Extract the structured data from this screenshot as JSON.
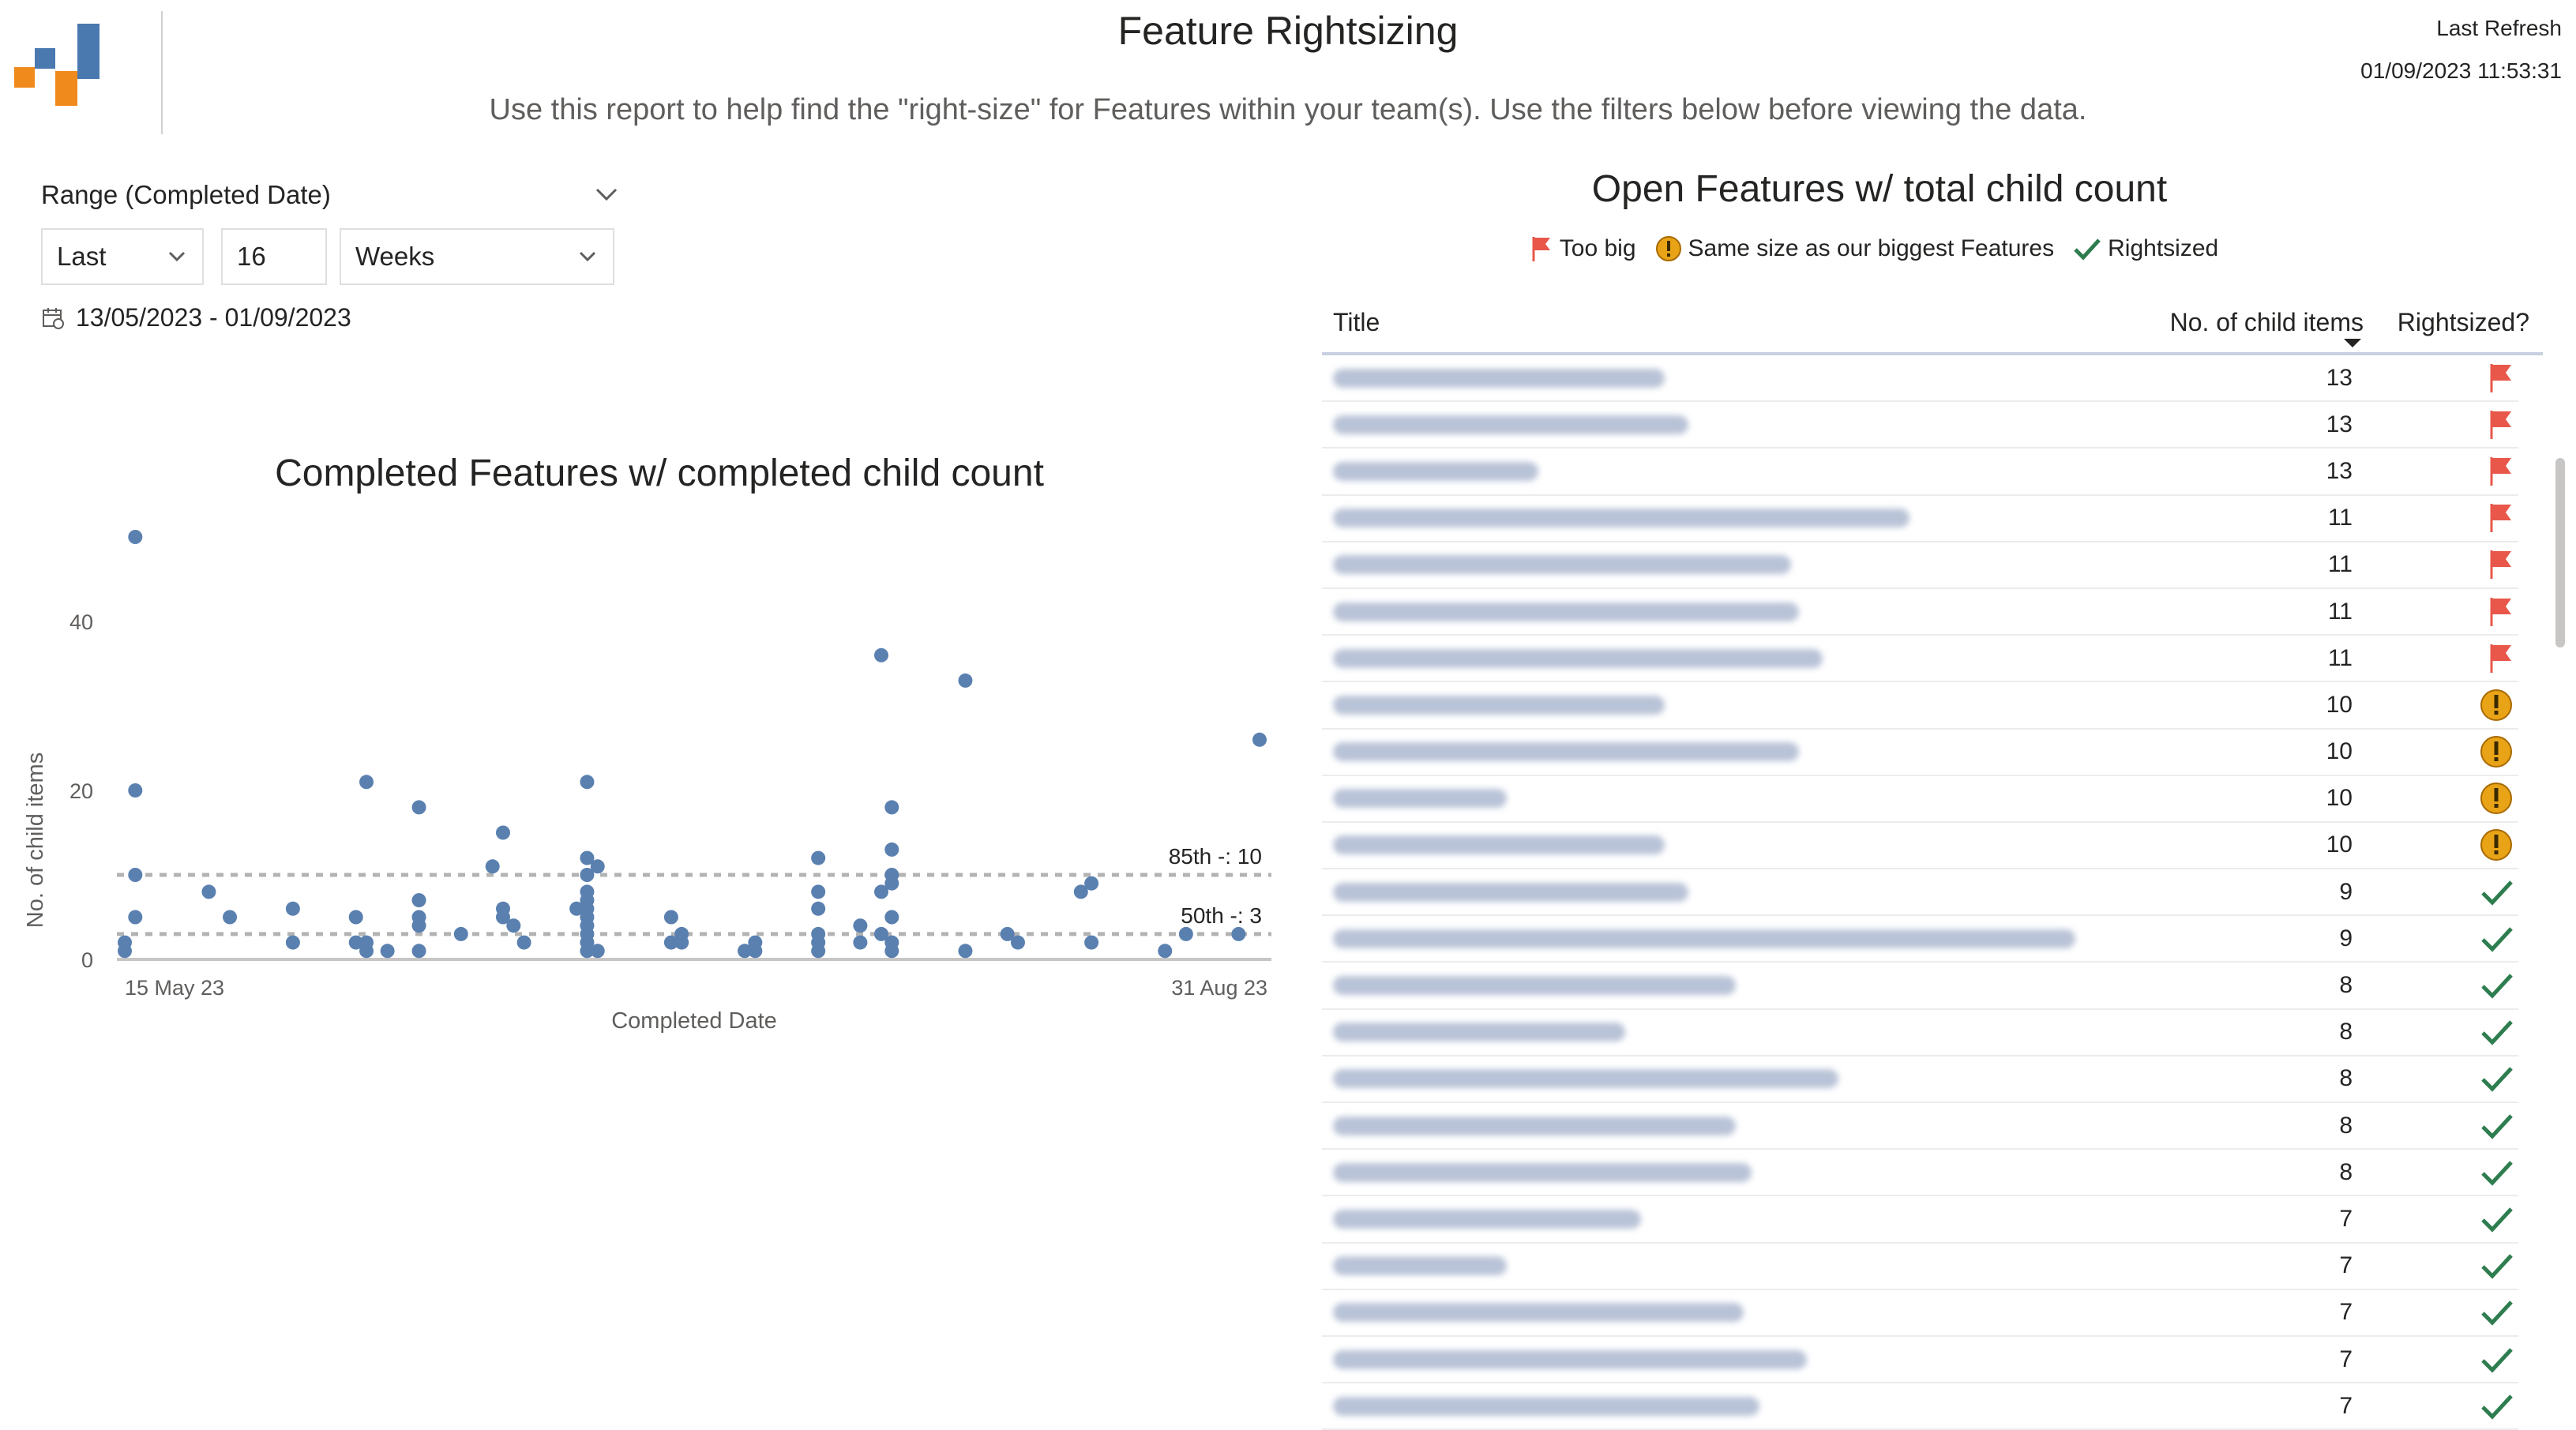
{
  "header": {
    "title": "Feature Rightsizing",
    "subtitle": "Use this report to help find the \"right-size\" for Features within your team(s). Use the filters below before viewing the data.",
    "last_refresh_label": "Last Refresh",
    "last_refresh_value": "01/09/2023 11:53:31"
  },
  "colors": {
    "logo_blue": "#4a79b0",
    "logo_orange": "#f08a1c",
    "dot": "#5a80b0",
    "flag": "#e8574a",
    "warning": "#e8a317",
    "check": "#2e7d4f"
  },
  "slicer": {
    "label": "Range (Completed Date)",
    "mode": "Last",
    "number": "16",
    "unit": "Weeks",
    "date_range": "13/05/2023 - 01/09/2023"
  },
  "scatter": {
    "title": "Completed Features w/ completed child count",
    "ylabel": "No. of child items",
    "xlabel": "Completed Date",
    "x_start_label": "15 May 23",
    "x_end_label": "31 Aug 23",
    "p85_label": "85th -: 10",
    "p50_label": "50th -: 3"
  },
  "chart_data": {
    "type": "scatter",
    "title": "Completed Features w/ completed child count",
    "xlabel": "Completed Date",
    "ylabel": "No. of child items",
    "yticks": [
      0,
      20,
      40
    ],
    "ylim": [
      0,
      50
    ],
    "xlim": [
      "2023-05-15",
      "2023-08-31"
    ],
    "x_tick_labels": [
      "15 May 23",
      "31 Aug 23"
    ],
    "reference_lines": [
      {
        "label": "85th -: 10",
        "value": 10,
        "style": "dotted"
      },
      {
        "label": "50th -: 3",
        "value": 3,
        "style": "dotted"
      }
    ],
    "series": [
      {
        "points": [
          {
            "x": "2023-05-15",
            "y": 2
          },
          {
            "x": "2023-05-15",
            "y": 1
          },
          {
            "x": "2023-05-16",
            "y": 50
          },
          {
            "x": "2023-05-16",
            "y": 20
          },
          {
            "x": "2023-05-16",
            "y": 10
          },
          {
            "x": "2023-05-16",
            "y": 5
          },
          {
            "x": "2023-05-23",
            "y": 8
          },
          {
            "x": "2023-05-25",
            "y": 5
          },
          {
            "x": "2023-05-31",
            "y": 6
          },
          {
            "x": "2023-05-31",
            "y": 2
          },
          {
            "x": "2023-06-06",
            "y": 5
          },
          {
            "x": "2023-06-06",
            "y": 2
          },
          {
            "x": "2023-06-07",
            "y": 21
          },
          {
            "x": "2023-06-07",
            "y": 2
          },
          {
            "x": "2023-06-07",
            "y": 1
          },
          {
            "x": "2023-06-09",
            "y": 1
          },
          {
            "x": "2023-06-12",
            "y": 18
          },
          {
            "x": "2023-06-12",
            "y": 7
          },
          {
            "x": "2023-06-12",
            "y": 5
          },
          {
            "x": "2023-06-12",
            "y": 4
          },
          {
            "x": "2023-06-12",
            "y": 1
          },
          {
            "x": "2023-06-16",
            "y": 3
          },
          {
            "x": "2023-06-19",
            "y": 11
          },
          {
            "x": "2023-06-20",
            "y": 15
          },
          {
            "x": "2023-06-20",
            "y": 6
          },
          {
            "x": "2023-06-20",
            "y": 5
          },
          {
            "x": "2023-06-21",
            "y": 4
          },
          {
            "x": "2023-06-22",
            "y": 2
          },
          {
            "x": "2023-06-27",
            "y": 6
          },
          {
            "x": "2023-06-28",
            "y": 21
          },
          {
            "x": "2023-06-28",
            "y": 12
          },
          {
            "x": "2023-06-28",
            "y": 10
          },
          {
            "x": "2023-06-28",
            "y": 8
          },
          {
            "x": "2023-06-28",
            "y": 7
          },
          {
            "x": "2023-06-28",
            "y": 6
          },
          {
            "x": "2023-06-28",
            "y": 5
          },
          {
            "x": "2023-06-28",
            "y": 4
          },
          {
            "x": "2023-06-28",
            "y": 3
          },
          {
            "x": "2023-06-28",
            "y": 2
          },
          {
            "x": "2023-06-28",
            "y": 1
          },
          {
            "x": "2023-06-29",
            "y": 11
          },
          {
            "x": "2023-06-29",
            "y": 1
          },
          {
            "x": "2023-07-06",
            "y": 5
          },
          {
            "x": "2023-07-06",
            "y": 2
          },
          {
            "x": "2023-07-07",
            "y": 3
          },
          {
            "x": "2023-07-07",
            "y": 2
          },
          {
            "x": "2023-07-13",
            "y": 1
          },
          {
            "x": "2023-07-14",
            "y": 2
          },
          {
            "x": "2023-07-14",
            "y": 1
          },
          {
            "x": "2023-07-20",
            "y": 12
          },
          {
            "x": "2023-07-20",
            "y": 8
          },
          {
            "x": "2023-07-20",
            "y": 6
          },
          {
            "x": "2023-07-20",
            "y": 3
          },
          {
            "x": "2023-07-20",
            "y": 2
          },
          {
            "x": "2023-07-20",
            "y": 1
          },
          {
            "x": "2023-07-24",
            "y": 4
          },
          {
            "x": "2023-07-24",
            "y": 2
          },
          {
            "x": "2023-07-26",
            "y": 36
          },
          {
            "x": "2023-07-26",
            "y": 8
          },
          {
            "x": "2023-07-26",
            "y": 3
          },
          {
            "x": "2023-07-27",
            "y": 18
          },
          {
            "x": "2023-07-27",
            "y": 13
          },
          {
            "x": "2023-07-27",
            "y": 10
          },
          {
            "x": "2023-07-27",
            "y": 9
          },
          {
            "x": "2023-07-27",
            "y": 5
          },
          {
            "x": "2023-07-27",
            "y": 2
          },
          {
            "x": "2023-07-27",
            "y": 1
          },
          {
            "x": "2023-08-03",
            "y": 33
          },
          {
            "x": "2023-08-03",
            "y": 1
          },
          {
            "x": "2023-08-07",
            "y": 3
          },
          {
            "x": "2023-08-08",
            "y": 2
          },
          {
            "x": "2023-08-14",
            "y": 8
          },
          {
            "x": "2023-08-15",
            "y": 9
          },
          {
            "x": "2023-08-15",
            "y": 2
          },
          {
            "x": "2023-08-22",
            "y": 1
          },
          {
            "x": "2023-08-24",
            "y": 3
          },
          {
            "x": "2023-08-29",
            "y": 3
          },
          {
            "x": "2023-08-31",
            "y": 26
          }
        ]
      }
    ]
  },
  "table": {
    "title": "Open Features w/ total child count",
    "legend": [
      {
        "icon": "flag",
        "label": "Too big"
      },
      {
        "icon": "warning",
        "label": "Same size as our biggest Features"
      },
      {
        "icon": "check",
        "label": "Rightsized"
      }
    ],
    "columns": [
      "Title",
      "No. of child items",
      "Rightsized?"
    ],
    "rows": [
      {
        "count": "13",
        "status": "flag",
        "blur": 0.42
      },
      {
        "count": "13",
        "status": "flag",
        "blur": 0.45
      },
      {
        "count": "13",
        "status": "flag",
        "blur": 0.26
      },
      {
        "count": "11",
        "status": "flag",
        "blur": 0.73
      },
      {
        "count": "11",
        "status": "flag",
        "blur": 0.58
      },
      {
        "count": "11",
        "status": "flag",
        "blur": 0.59
      },
      {
        "count": "11",
        "status": "flag",
        "blur": 0.62
      },
      {
        "count": "10",
        "status": "warning",
        "blur": 0.42
      },
      {
        "count": "10",
        "status": "warning",
        "blur": 0.59
      },
      {
        "count": "10",
        "status": "warning",
        "blur": 0.22
      },
      {
        "count": "10",
        "status": "warning",
        "blur": 0.42
      },
      {
        "count": "9",
        "status": "check",
        "blur": 0.45
      },
      {
        "count": "9",
        "status": "check",
        "blur": 0.94
      },
      {
        "count": "8",
        "status": "check",
        "blur": 0.51
      },
      {
        "count": "8",
        "status": "check",
        "blur": 0.37
      },
      {
        "count": "8",
        "status": "check",
        "blur": 0.64
      },
      {
        "count": "8",
        "status": "check",
        "blur": 0.51
      },
      {
        "count": "8",
        "status": "check",
        "blur": 0.53
      },
      {
        "count": "7",
        "status": "check",
        "blur": 0.39
      },
      {
        "count": "7",
        "status": "check",
        "blur": 0.22
      },
      {
        "count": "7",
        "status": "check",
        "blur": 0.52
      },
      {
        "count": "7",
        "status": "check",
        "blur": 0.6
      },
      {
        "count": "7",
        "status": "check",
        "blur": 0.54
      }
    ]
  }
}
